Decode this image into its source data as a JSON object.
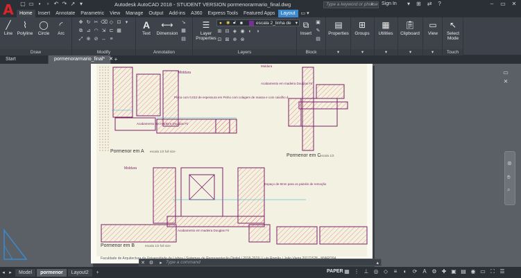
{
  "titlebar": {
    "title": "Autodesk AutoCAD 2018 - STUDENT VERSION    pormenorarmario_final.dwg",
    "search_placeholder": "Type a keyword or phrase",
    "signin": "Sign In"
  },
  "tabs": [
    "Home",
    "Insert",
    "Annotate",
    "Parametric",
    "View",
    "Manage",
    "Output",
    "Add-ins",
    "A360",
    "Express Tools",
    "Featured Apps",
    "Layout"
  ],
  "ribbon": {
    "draw": {
      "label": "Draw",
      "tools": [
        "Line",
        "Polyline",
        "Circle",
        "Arc"
      ]
    },
    "modify": {
      "label": "Modify"
    },
    "annotation": {
      "label": "Annotation",
      "tools": [
        "Text",
        "Dimension"
      ]
    },
    "layers": {
      "label": "Layers",
      "layer_properties": "Layer Properties",
      "current_layer": "escala 2_linha de"
    },
    "block": {
      "label": "Block",
      "insert": "Insert"
    },
    "properties": "Properties",
    "groups": "Groups",
    "utilities": "Utilities",
    "clipboard": "Clipboard",
    "view": "View",
    "select_mode": "Select Mode",
    "touch": "Touch"
  },
  "doc_tabs": {
    "start": "Start",
    "active": "pormenorarmario_final*"
  },
  "drawing": {
    "labels": {
      "pormenor_a": "Pormenor em A",
      "pormenor_a_scale": "escala 1/2 full size",
      "pormenor_b": "Pormenor em B",
      "pormenor_b_scale": "escala 1/2 full size",
      "pormenor_c": "Pormenor em C",
      "pormenor_c_scale": "escala 1/2",
      "moldura": "Moldura",
      "moldura2": "Moldura",
      "moldura3": "Moldura",
      "acab1": "Acabamento em madeira Douglas Fir",
      "acab2": "Acabamento em madeira Douglas Fir",
      "acab3": "Acabamento em madeira Douglas Fir",
      "placa": "Placa com 0,010 de espessura em Pinho com colagem de massa e com caixilho d...",
      "espaco": "Espaço de 8mm para os painéis de remoção"
    },
    "footer": "Faculdade de Arquitectura da Universidade de Lisboa | Sistemas de Representação Digital | 2018-2019 | Luís Romão | João Vieira 20171528 - MIARQ04"
  },
  "command": {
    "placeholder": "Type a command"
  },
  "statusbar": {
    "layouts": [
      "Model",
      "pormenor",
      "Layout2"
    ],
    "active_layout": "pormenor",
    "paper": "PAPER"
  }
}
